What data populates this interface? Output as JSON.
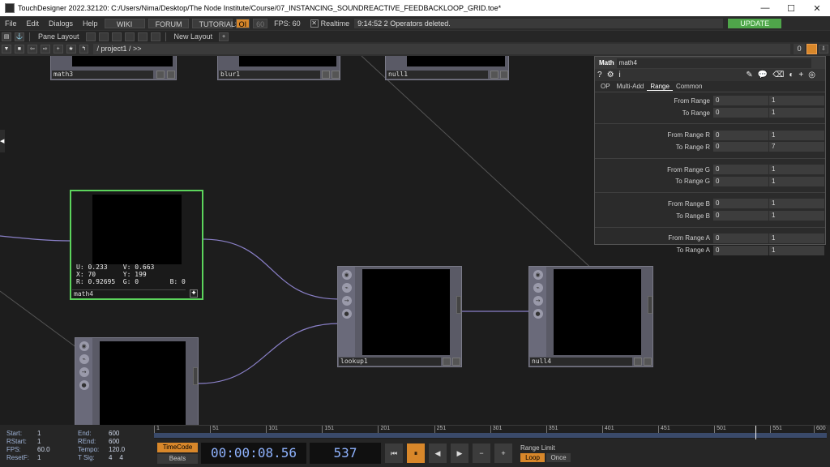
{
  "window": {
    "title": "TouchDesigner 2022.32120: C:/Users/Nima/Desktop/The Node Institute/Course/07_INSTANCING_SOUNDREACTIVE_FEEDBACKLOOP_GRID.toe*",
    "minimize": "—",
    "maximize": "☐",
    "close": "✕"
  },
  "menubar": {
    "items": [
      "File",
      "Edit",
      "Dialogs",
      "Help"
    ],
    "wiki": "WIKI",
    "forum": "FORUM",
    "tutorials": "TUTORIALS",
    "oi": "OI",
    "sixty": "60",
    "fps_label": "FPS:",
    "fps_value": "60",
    "realtime_label": "Realtime",
    "status": "9:14:52 2 Operators deleted.",
    "update": "UPDATE"
  },
  "panebar": {
    "pane_layout": "Pane Layout",
    "new_layout": "New Layout",
    "plus": "+"
  },
  "pathbar": {
    "path": "/ project1 / >>",
    "num": "0"
  },
  "nodes": {
    "math3": "math3",
    "blur1": "blur1",
    "null1": "null1",
    "math4": "math4",
    "lookup1": "lookup1",
    "null4": "null4",
    "math4_info": {
      "line1": "U: 0.233    V: 0.663",
      "line2": "X: 70       Y: 199",
      "line3": "R: 0.92695  G: 0        B: 0"
    }
  },
  "params": {
    "op_type": "Math",
    "op_name": "math4",
    "tabs": [
      "OP",
      "Multi-Add",
      "Range",
      "Common"
    ],
    "active_tab": "Range",
    "groups": [
      [
        {
          "label": "From Range",
          "v1": "0",
          "v2": "1"
        },
        {
          "label": "To Range",
          "v1": "0",
          "v2": "1"
        }
      ],
      [
        {
          "label": "From Range R",
          "v1": "0",
          "v2": "1"
        },
        {
          "label": "To Range R",
          "v1": "0",
          "v2": "7"
        }
      ],
      [
        {
          "label": "From Range G",
          "v1": "0",
          "v2": "1"
        },
        {
          "label": "To Range G",
          "v1": "0",
          "v2": "1"
        }
      ],
      [
        {
          "label": "From Range B",
          "v1": "0",
          "v2": "1"
        },
        {
          "label": "To Range B",
          "v1": "0",
          "v2": "1"
        }
      ],
      [
        {
          "label": "From Range A",
          "v1": "0",
          "v2": "1"
        },
        {
          "label": "To Range A",
          "v1": "0",
          "v2": "1"
        }
      ]
    ]
  },
  "timeline": {
    "stats": {
      "start_label": "Start:",
      "start": "1",
      "rstart_label": "RStart:",
      "rstart": "1",
      "fps_label": "FPS:",
      "fps": "60.0",
      "resetf_label": "ResetF:",
      "resetf": "1",
      "end_label": "End:",
      "end": "600",
      "rend_label": "REnd:",
      "rend": "600",
      "tempo_label": "Tempo:",
      "tempo": "120.0",
      "tsig_label": "T Sig:",
      "tsig1": "4",
      "tsig2": "4"
    },
    "ticks": [
      "1",
      "51",
      "101",
      "151",
      "201",
      "251",
      "301",
      "351",
      "401",
      "451",
      "501",
      "551",
      "600"
    ],
    "timecode_btn": "TimeCode",
    "beats_btn": "Beats",
    "timecode": "00:00:08.56",
    "frame": "537",
    "range_limit": "Range Limit",
    "loop": "Loop",
    "once": "Once"
  }
}
